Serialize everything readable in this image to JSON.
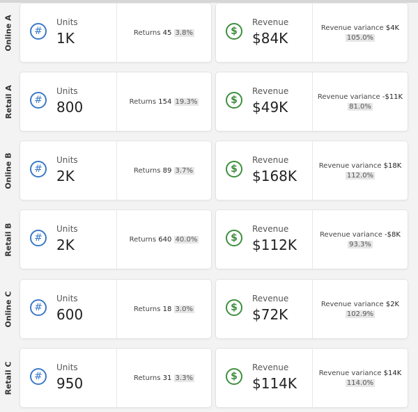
{
  "labels": {
    "units": "Units",
    "returns": "Returns",
    "revenue": "Revenue",
    "variance": "Revenue variance"
  },
  "icons": {
    "units": "#",
    "revenue": "$"
  },
  "colors": {
    "units_icon": "#3b79c6",
    "revenue_icon": "#3e8e3e"
  },
  "rows": [
    {
      "name": "Online A",
      "units": "1K",
      "returns_count": "45",
      "returns_pct": "3.8%",
      "revenue": "$84K",
      "variance_value": "$4K",
      "variance_pct": "105.0%"
    },
    {
      "name": "Retail A",
      "units": "800",
      "returns_count": "154",
      "returns_pct": "19.3%",
      "revenue": "$49K",
      "variance_value": "-$11K",
      "variance_pct": "81.0%"
    },
    {
      "name": "Online B",
      "units": "2K",
      "returns_count": "89",
      "returns_pct": "3.7%",
      "revenue": "$168K",
      "variance_value": "$18K",
      "variance_pct": "112.0%"
    },
    {
      "name": "Retail B",
      "units": "2K",
      "returns_count": "640",
      "returns_pct": "40.0%",
      "revenue": "$112K",
      "variance_value": "-$8K",
      "variance_pct": "93.3%"
    },
    {
      "name": "Online C",
      "units": "600",
      "returns_count": "18",
      "returns_pct": "3.0%",
      "revenue": "$72K",
      "variance_value": "$2K",
      "variance_pct": "102.9%"
    },
    {
      "name": "Retail C",
      "units": "950",
      "returns_count": "31",
      "returns_pct": "3.3%",
      "revenue": "$114K",
      "variance_value": "$14K",
      "variance_pct": "114.0%"
    }
  ]
}
